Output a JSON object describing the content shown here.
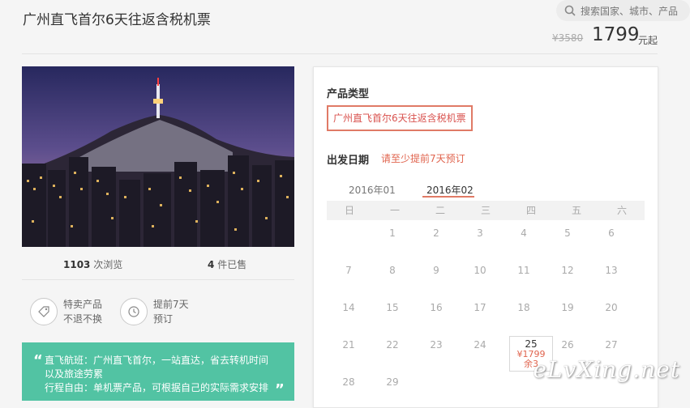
{
  "product": {
    "title": "广州直飞首尔6天往返含税机票",
    "price_original": "¥3580",
    "price_current": "1799",
    "price_unit": "元起"
  },
  "search": {
    "placeholder": "搜索国家、城市、产品"
  },
  "stats": {
    "views_count": "1103",
    "views_label": "次浏览",
    "sold_count": "4",
    "sold_label": "件已售"
  },
  "features": [
    {
      "icon": "tag-icon",
      "line1": "特卖产品",
      "line2": "不退不换"
    },
    {
      "icon": "clock-icon",
      "line1": "提前7天",
      "line2": "预订"
    }
  ],
  "highlight": {
    "lines": [
      "直飞航班：广州直飞首尔，一站直达，省去转机时间",
      "以及旅途劳累",
      "行程自由：单机票产品，可根据自己的实际需求安排"
    ]
  },
  "booking": {
    "type_label": "产品类型",
    "type_option": "广州直飞首尔6天往返含税机票",
    "date_label": "出发日期",
    "date_note": "请至少提前7天预订",
    "months": [
      "2016年01",
      "2016年02"
    ],
    "weekdays": [
      "日",
      "一",
      "二",
      "三",
      "四",
      "五",
      "六"
    ],
    "days": [
      [
        "",
        "1",
        "2",
        "3",
        "4",
        "5",
        "6"
      ],
      [
        "7",
        "8",
        "9",
        "10",
        "11",
        "12",
        "13"
      ],
      [
        "14",
        "15",
        "16",
        "17",
        "18",
        "19",
        "20"
      ],
      [
        "21",
        "22",
        "23",
        "24",
        "25",
        "26",
        "27"
      ],
      [
        "28",
        "29",
        "",
        "",
        "",
        "",
        ""
      ]
    ],
    "selected": {
      "day": "25",
      "price": "¥1799",
      "remaining": "余3"
    }
  },
  "watermark": "eLvXing.net",
  "colors": {
    "accent": "#e0644e",
    "highlight_bg": "#52c3a3"
  }
}
